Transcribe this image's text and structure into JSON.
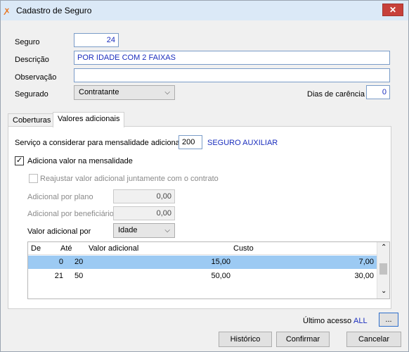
{
  "window": {
    "title": "Cadastro de Seguro",
    "close": "✕"
  },
  "form": {
    "seguro_label": "Seguro",
    "seguro_value": "24",
    "descricao_label": "Descrição",
    "descricao_value": "POR IDADE COM 2 FAIXAS",
    "observacao_label": "Observação",
    "observacao_value": "",
    "segurado_label": "Segurado",
    "segurado_value": "Contratante",
    "dias_label": "Dias de carência",
    "dias_value": "0"
  },
  "tabs": [
    {
      "label": "Coberturas"
    },
    {
      "label": "Valores adicionais"
    }
  ],
  "adicional": {
    "servico_label": "Serviço a considerar para mensalidade adicional",
    "servico_code": "200",
    "servico_name": "SEGURO AUXILIAR",
    "adiciona_label": "Adiciona valor na mensalidade",
    "adiciona_checked": true,
    "reajustar_label": "Reajustar valor adicional juntamente com o contrato",
    "por_plano_label": "Adicional por plano",
    "por_plano_value": "0,00",
    "por_benef_label": "Adicional por beneficiário",
    "por_benef_value": "0,00",
    "valor_por_label": "Valor adicional por",
    "valor_por_value": "Idade"
  },
  "grid": {
    "columns": [
      "De",
      "Até",
      "Valor adicional",
      "Custo"
    ],
    "rows": [
      {
        "de": "0",
        "ate": "20",
        "valor": "15,00",
        "custo": "7,00"
      },
      {
        "de": "21",
        "ate": "50",
        "valor": "50,00",
        "custo": "30,00"
      }
    ]
  },
  "footer": {
    "ultimo_label": "Último acesso",
    "ultimo_value": "ALL",
    "ellipsis": "...",
    "historico": "Histórico",
    "confirmar": "Confirmar",
    "cancelar": "Cancelar"
  },
  "icons": {
    "app": "orange-logo-icon",
    "close": "close-icon"
  },
  "colors": {
    "title_bg": "#dbe9f7",
    "close_bg": "#c7403a",
    "selection": "#9ccaf3",
    "value_text": "#1a2dbd"
  }
}
